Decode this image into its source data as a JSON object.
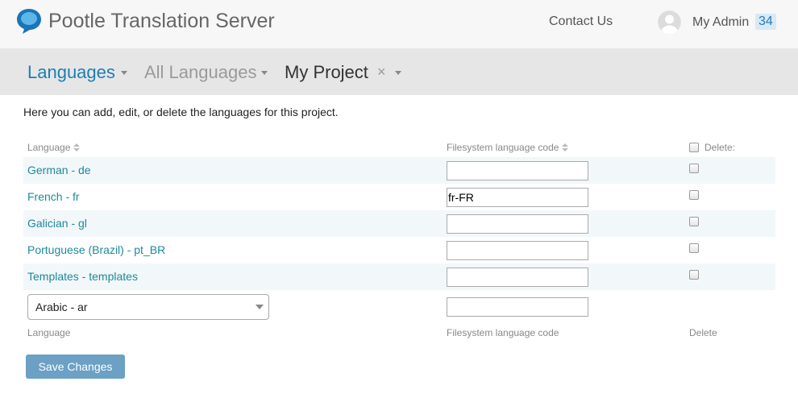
{
  "header": {
    "site_title": "Pootle Translation Server",
    "contact_label": "Contact Us",
    "user_name": "My Admin",
    "user_score": "34",
    "logo_icon": "speech-bubble-logo-icon",
    "avatar_icon": "user-avatar-icon"
  },
  "breadcrumb": {
    "languages": "Languages",
    "all_languages": "All Languages",
    "project": "My Project",
    "close": "×"
  },
  "intro_text": "Here you can add, edit, or delete the languages for this project.",
  "table": {
    "col_language": "Language",
    "col_code": "Filesystem language code",
    "col_delete": "Delete:",
    "rows": [
      {
        "name": "German - de",
        "code": ""
      },
      {
        "name": "French - fr",
        "code": "fr-FR"
      },
      {
        "name": "Galician - gl",
        "code": ""
      },
      {
        "name": "Portuguese (Brazil) - pt_BR",
        "code": ""
      },
      {
        "name": "Templates - templates",
        "code": ""
      }
    ],
    "new_row": {
      "selected_language": "Arabic - ar",
      "code": ""
    },
    "footer_language": "Language",
    "footer_code": "Filesystem language code",
    "footer_delete": "Delete"
  },
  "save_label": "Save Changes",
  "colors": {
    "link": "#1e8a9a",
    "accent": "#1e7eb2",
    "button": "#6ca0c4"
  }
}
